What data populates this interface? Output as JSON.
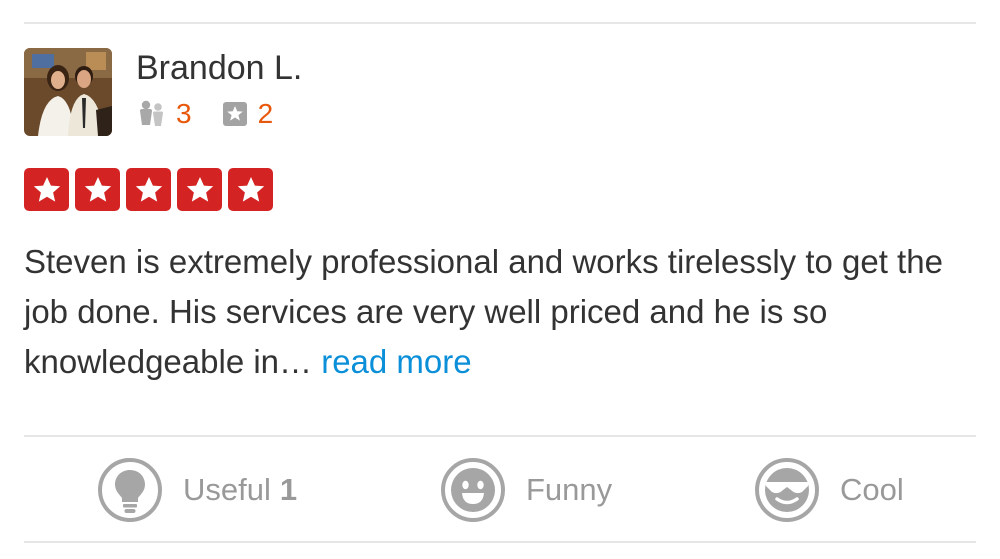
{
  "review": {
    "author": {
      "name": "Brandon L.",
      "avatar": "user-photo",
      "friends_icon": "friends-icon",
      "friends_count": "3",
      "reviews_icon": "review-star-icon",
      "reviews_count": "2"
    },
    "rating": {
      "stars": 5,
      "max": 5,
      "color": "#d32323"
    },
    "text": "Steven is extremely professional and works tirelessly to get the job done. His services are very well priced and he is so knowledgeable in…",
    "read_more": "read more"
  },
  "feedback": {
    "useful": {
      "icon": "lightbulb-icon",
      "label": "Useful",
      "count": "1"
    },
    "funny": {
      "icon": "smiley-icon",
      "label": "Funny"
    },
    "cool": {
      "icon": "sunglasses-face-icon",
      "label": "Cool"
    }
  },
  "colors": {
    "accent_orange": "#e8580c",
    "link_blue": "#0b8fd8",
    "star_red": "#d32323",
    "muted_gray": "#999999"
  }
}
